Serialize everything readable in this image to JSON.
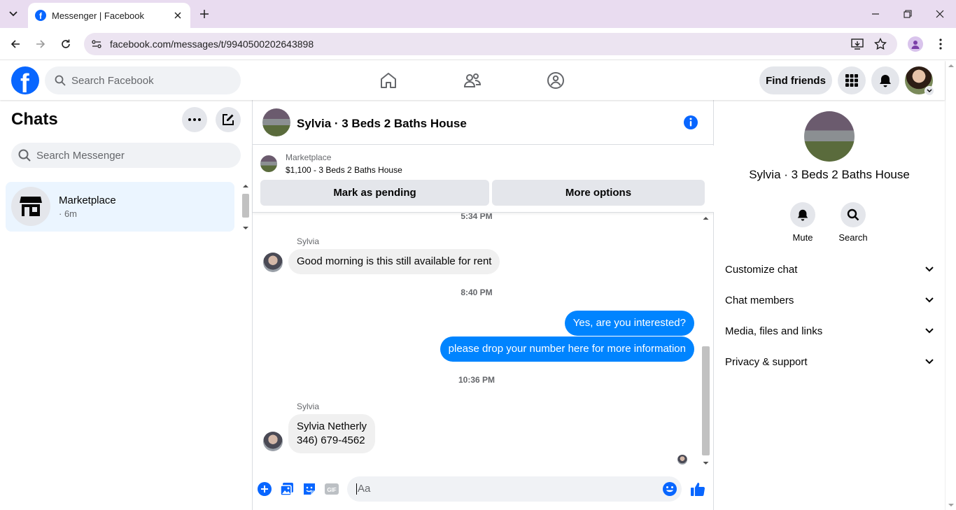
{
  "browser": {
    "tab_title": "Messenger | Facebook",
    "url": "facebook.com/messages/t/9940500202643898"
  },
  "fb": {
    "search_placeholder": "Search Facebook",
    "find_friends": "Find friends"
  },
  "sidebar": {
    "title": "Chats",
    "search_placeholder": "Search Messenger",
    "chats": [
      {
        "name": "Marketplace",
        "time": "· 6m"
      }
    ]
  },
  "conversation": {
    "title": "Sylvia · 3 Beds 2 Baths House",
    "marketplace_label": "Marketplace",
    "listing": "$1,100 - 3 Beds 2 Baths House",
    "mark_pending": "Mark as pending",
    "more_options": "More options",
    "messages": [
      {
        "type": "timestamp",
        "text": "5:34 PM"
      },
      {
        "type": "sender",
        "text": "Sylvia"
      },
      {
        "type": "in",
        "text": "Good morning is this still available for rent"
      },
      {
        "type": "timestamp",
        "text": "8:40 PM"
      },
      {
        "type": "out",
        "text": "Yes, are you interested?"
      },
      {
        "type": "out",
        "text": "please drop your number here for more information"
      },
      {
        "type": "timestamp",
        "text": "10:36 PM"
      },
      {
        "type": "sender",
        "text": "Sylvia"
      },
      {
        "type": "in",
        "lines": [
          "Sylvia Netherly",
          "346) 679-4562"
        ]
      }
    ],
    "composer_placeholder": "Aa"
  },
  "details": {
    "name": "Sylvia · 3 Beds 2 Baths House",
    "actions": [
      {
        "label": "Mute",
        "icon": "bell-icon"
      },
      {
        "label": "Search",
        "icon": "search-icon"
      }
    ],
    "sections": [
      "Customize chat",
      "Chat members",
      "Media, files and links",
      "Privacy & support"
    ]
  },
  "colors": {
    "fb_blue": "#0866ff",
    "bubble_out": "#0084ff",
    "bubble_in": "#f0f0f0",
    "selected_chat": "#ebf5ff",
    "chrome_tabstrip": "#e9dcf0"
  }
}
